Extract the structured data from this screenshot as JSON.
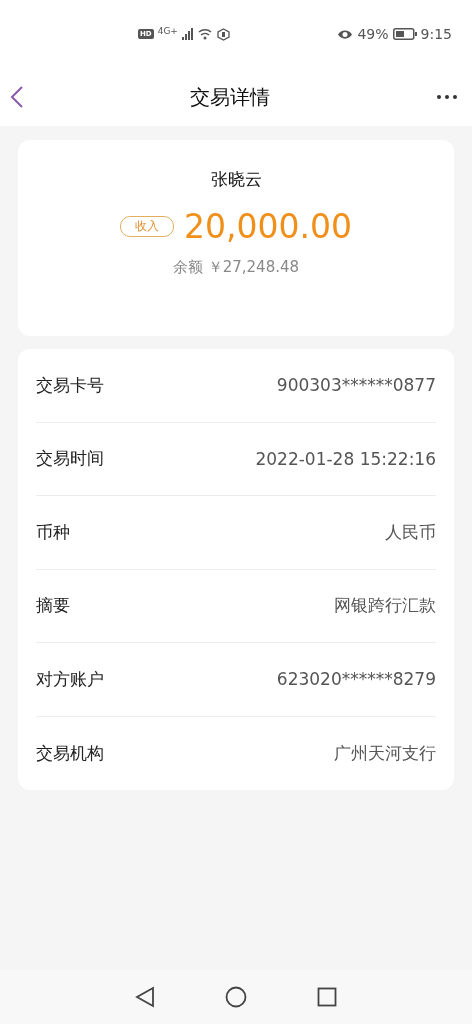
{
  "status_bar": {
    "hd": "HD",
    "network": "4G+",
    "battery": "49%",
    "time": "9:15"
  },
  "header": {
    "title": "交易详情"
  },
  "summary": {
    "name": "张晓云",
    "tag": "收入",
    "amount": "20,000.00",
    "balance_label": "余额",
    "balance": "￥27,248.48"
  },
  "details": [
    {
      "label": "交易卡号",
      "value": "900303******0877"
    },
    {
      "label": "交易时间",
      "value": "2022-01-28 15:22:16"
    },
    {
      "label": "币种",
      "value": "人民币"
    },
    {
      "label": "摘要",
      "value": "网银跨行汇款"
    },
    {
      "label": "对方账户",
      "value": "623020******8279"
    },
    {
      "label": "交易机构",
      "value": "广州天河支行"
    }
  ]
}
